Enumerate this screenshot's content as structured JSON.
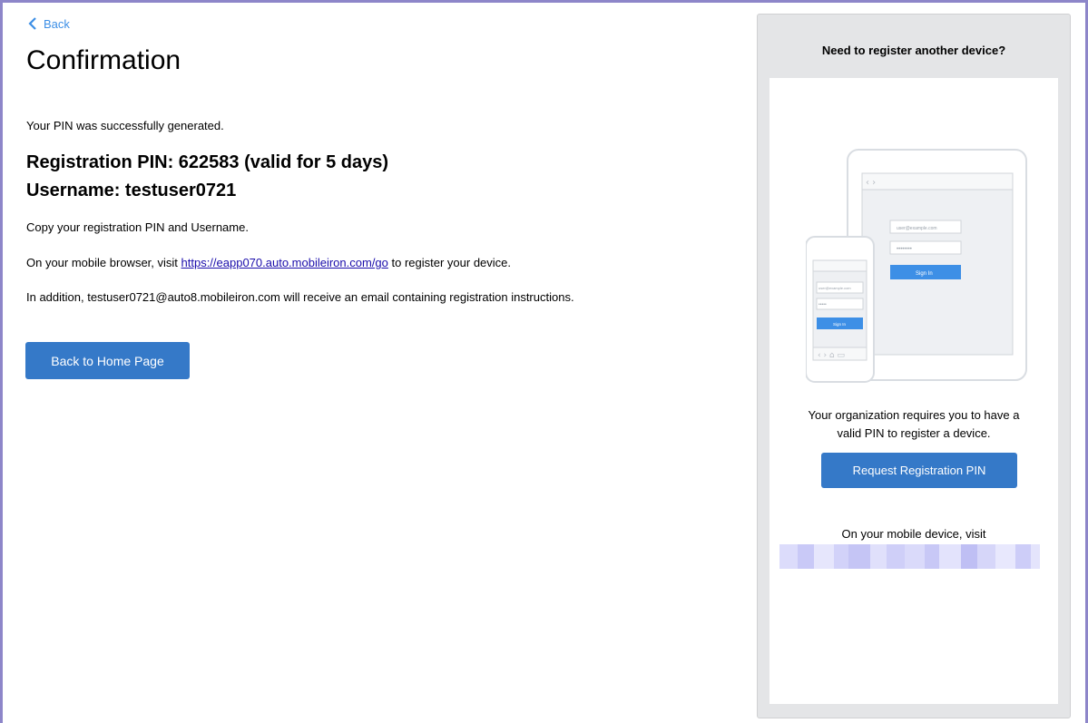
{
  "back": {
    "label": "Back"
  },
  "page": {
    "title": "Confirmation",
    "success_text": "Your PIN was successfully generated.",
    "pin_line": "Registration PIN: 622583 (valid for 5 days)",
    "username_line": "Username: testuser0721",
    "copy_text": "Copy your registration PIN and Username.",
    "visit_prefix": "On your mobile browser, visit ",
    "visit_url": "https://eapp070.auto.mobileiron.com/go",
    "visit_suffix": " to register your device.",
    "addition_text": "In addition, testuser0721@auto8.mobileiron.com will receive an email containing registration instructions.",
    "home_button": "Back to Home Page"
  },
  "side": {
    "heading": "Need to register another device?",
    "illustration": {
      "tablet_email": "user@example.com",
      "tablet_signin": "Sign In",
      "phone_email": "user@example.com",
      "phone_signin": "Sign In"
    },
    "org_line1": "Your organization requires you to have a",
    "org_line2": "valid PIN to register a device.",
    "request_button": "Request Registration PIN",
    "mobile_visit": "On your mobile device, visit"
  },
  "colors": {
    "accent": "#3579c8",
    "link": "#1a0dab",
    "back_link": "#3d8fe6",
    "frame": "#8d86c9"
  }
}
